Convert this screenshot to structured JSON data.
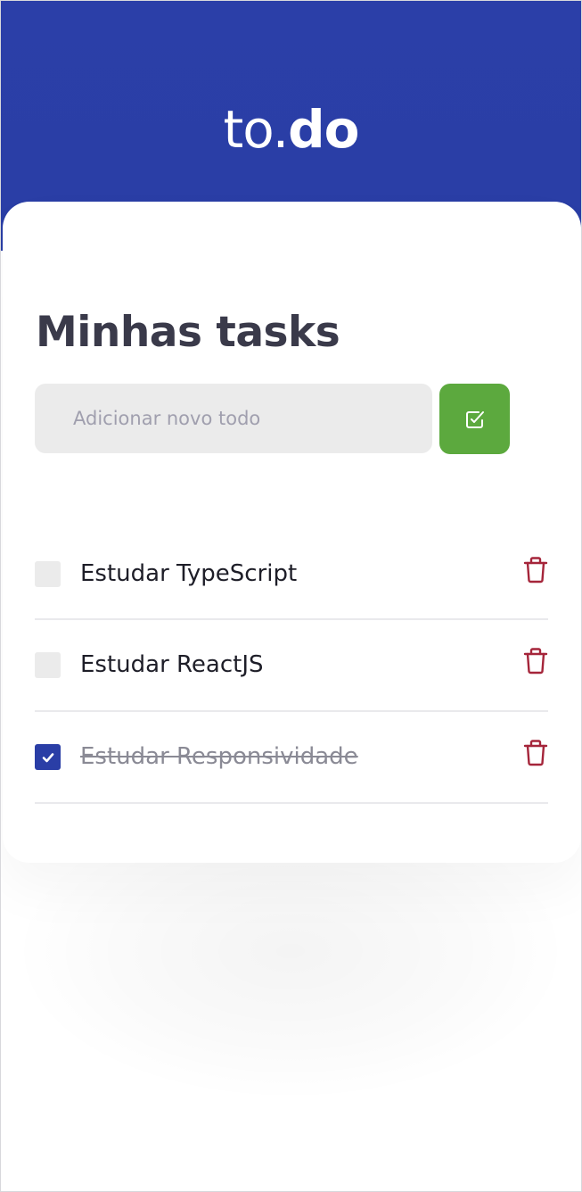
{
  "header": {
    "logo_light": "to.",
    "logo_bold": "do"
  },
  "main": {
    "title": "Minhas tasks",
    "new_todo": {
      "value": "",
      "placeholder": "Adicionar novo todo"
    },
    "add_button_icon": "checkbox-check-icon",
    "tasks": [
      {
        "title": "Estudar TypeScript",
        "done": false
      },
      {
        "title": "Estudar ReactJS",
        "done": false
      },
      {
        "title": "Estudar Responsividade",
        "done": true
      }
    ],
    "delete_icon": "trash-icon"
  },
  "colors": {
    "header_bg": "#2a3ea6",
    "add_button": "#5ca93e",
    "checked_box": "#2a3ea6",
    "delete_icon": "#a5253a",
    "title_text": "#3a3a4a"
  }
}
